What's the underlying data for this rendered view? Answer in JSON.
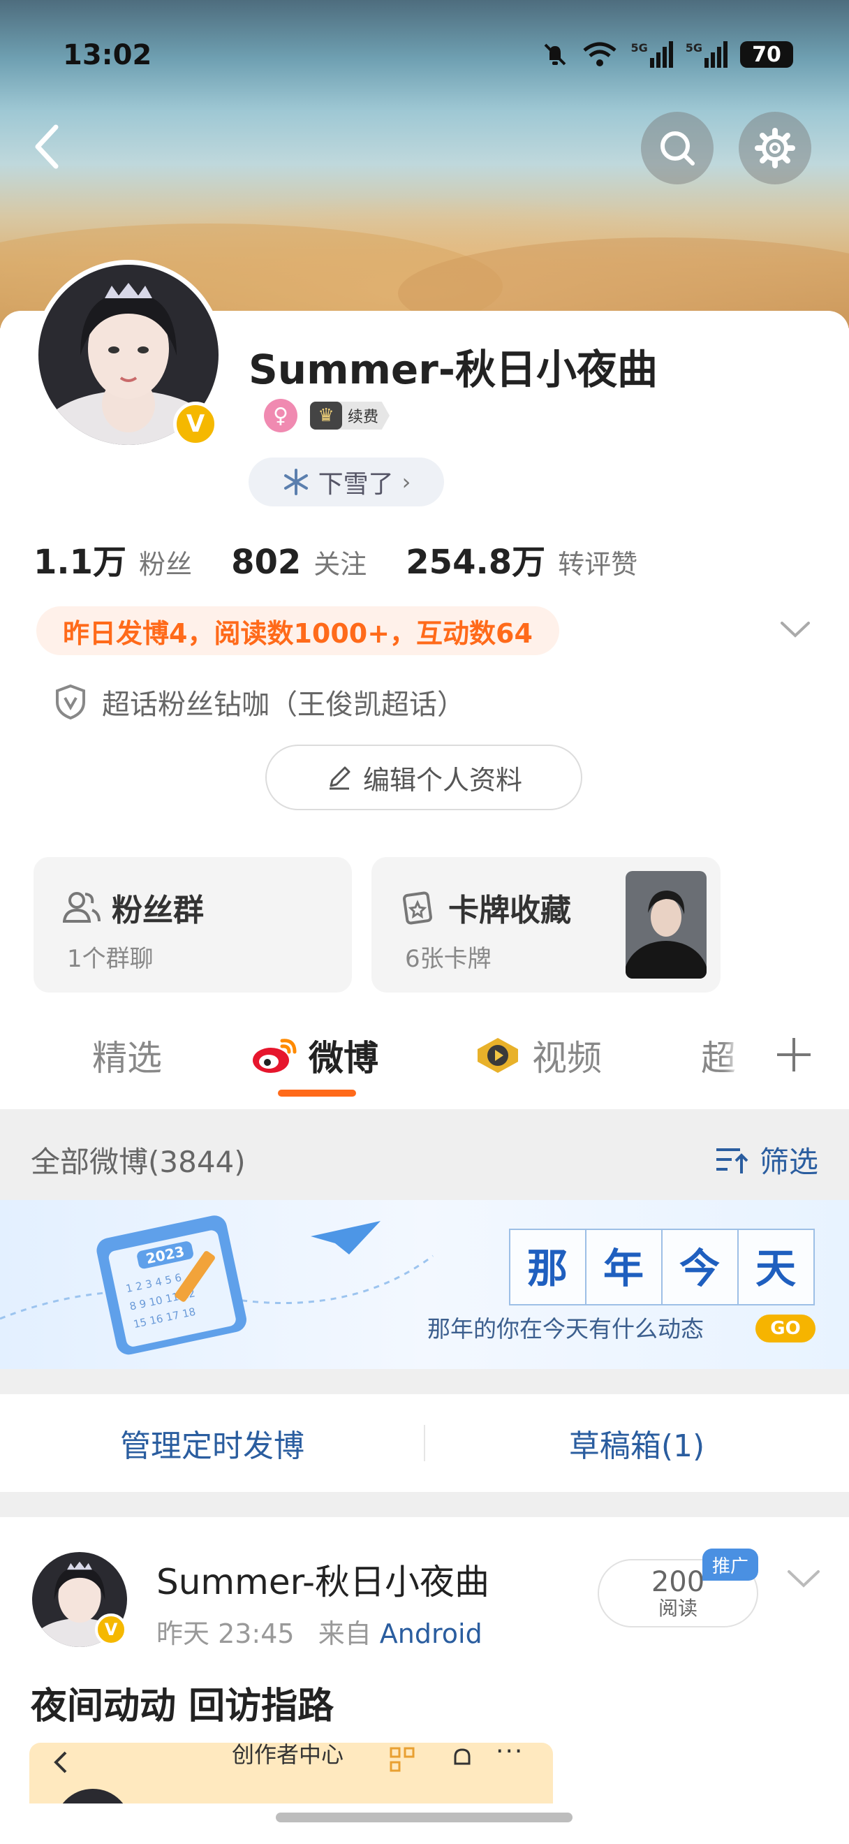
{
  "status_bar": {
    "time": "13:02",
    "network1": "5G",
    "network2": "5G",
    "battery": "70"
  },
  "header": {
    "back_icon": "back-icon",
    "search_icon": "search-icon",
    "settings_icon": "gear-icon"
  },
  "profile": {
    "name": "Summer-秋日小夜曲",
    "verified_badge": "V",
    "vip_label": "续费",
    "weather_label": "下雪了",
    "stats": [
      {
        "value": "1.1万",
        "label": "粉丝"
      },
      {
        "value": "802",
        "label": "关注"
      },
      {
        "value": "254.8万",
        "label": "转评赞"
      }
    ],
    "activity_text": "昨日发博4，阅读数1000+，互动数64",
    "fan_tag": "超话粉丝钻咖（王俊凯超话）",
    "edit_button": "编辑个人资料"
  },
  "tiles": {
    "fan_group": {
      "title": "粉丝群",
      "subtitle": "1个群聊"
    },
    "cards": {
      "title": "卡牌收藏",
      "subtitle": "6张卡牌"
    }
  },
  "tabs": [
    {
      "label": "精选",
      "active": false
    },
    {
      "label": "微博",
      "active": true
    },
    {
      "label": "视频",
      "active": false
    },
    {
      "label": "超",
      "active": false
    }
  ],
  "feed": {
    "section_title": "全部微博(3844)",
    "filter_label": "筛选",
    "promo": {
      "title_chars": [
        "那",
        "年",
        "今",
        "天"
      ],
      "subtitle": "那年的你在今天有什么动态",
      "go": "GO",
      "calendar_year": "2023"
    },
    "schedule_label": "管理定时发博",
    "drafts_label": "草稿箱(1)"
  },
  "post": {
    "author": "Summer-秋日小夜曲",
    "time": "昨天 23:45",
    "from_prefix": "来自",
    "source": "Android",
    "reads_count": "200",
    "reads_label": "阅读",
    "promo_tag": "推广",
    "text": "夜间动动 回访指路",
    "thumb_title": "创作者中心"
  },
  "colors": {
    "accent": "#ff6a1a",
    "link_blue": "#2a5d9f",
    "verified": "#f5b800"
  }
}
